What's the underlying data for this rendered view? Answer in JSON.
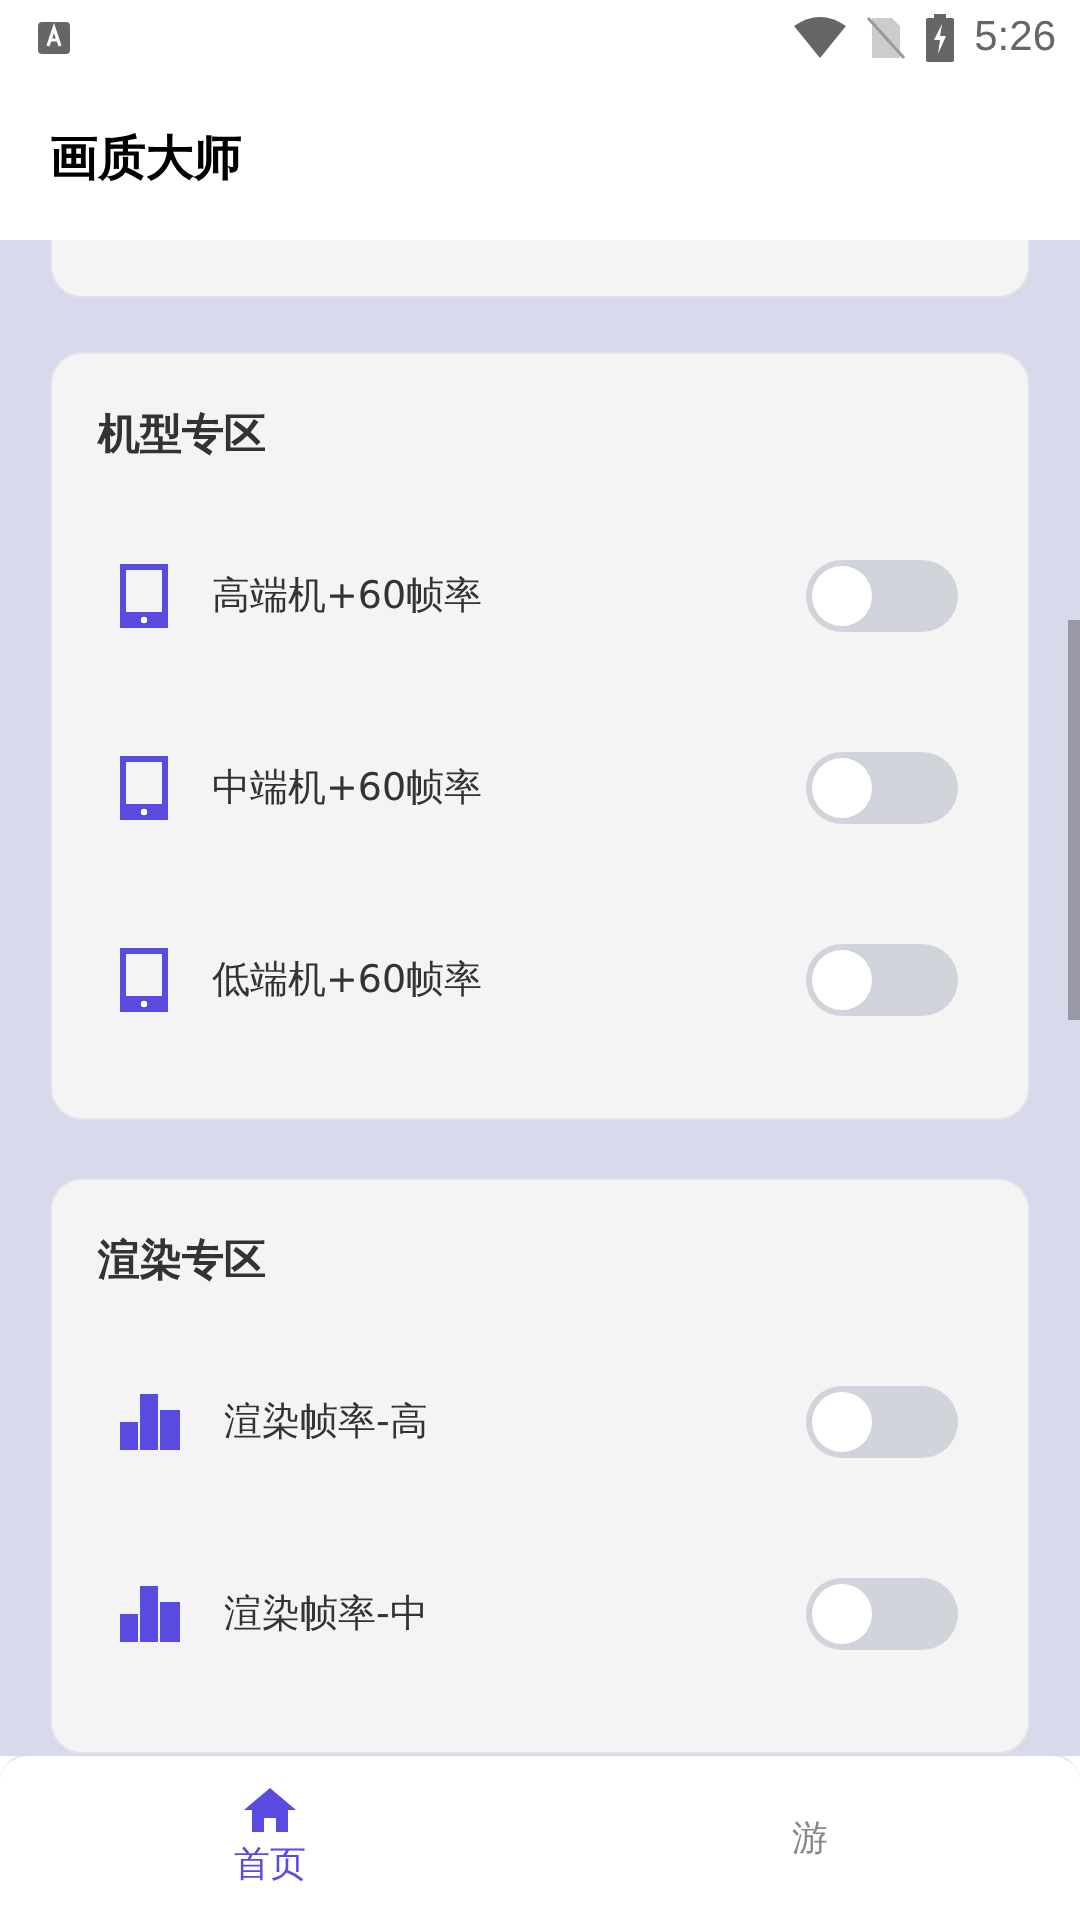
{
  "status_bar": {
    "time": "5:26"
  },
  "app_bar": {
    "title": "画质大师"
  },
  "sections": [
    {
      "title": "机型专区",
      "items": [
        {
          "kind": "phone",
          "label": "高端机+60帧率",
          "on": false
        },
        {
          "kind": "phone",
          "label": "中端机+60帧率",
          "on": false
        },
        {
          "kind": "phone",
          "label": "低端机+60帧率",
          "on": false
        }
      ]
    },
    {
      "title": "渲染专区",
      "items": [
        {
          "kind": "bars",
          "label": "渲染帧率-高",
          "on": false
        },
        {
          "kind": "bars",
          "label": "渲染帧率-中",
          "on": false
        }
      ]
    }
  ],
  "bottom_nav": [
    {
      "kind": "home",
      "label": "首页",
      "selected": true
    },
    {
      "kind": "game",
      "label": "游",
      "selected": false
    }
  ]
}
